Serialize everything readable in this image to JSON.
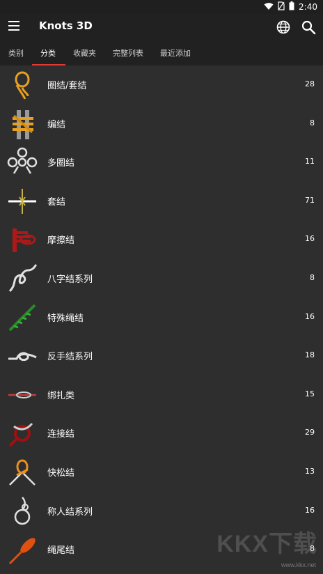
{
  "status_bar": {
    "time": "2:40"
  },
  "app_bar": {
    "title": "Knots 3D"
  },
  "tabs": [
    {
      "label": "类别"
    },
    {
      "label": "分类"
    },
    {
      "label": "收藏夹"
    },
    {
      "label": "完整列表"
    },
    {
      "label": "最近添加"
    }
  ],
  "categories": [
    {
      "label": "圈结/套结",
      "count": "28",
      "color": "#e8a020"
    },
    {
      "label": "编结",
      "count": "8",
      "color": "#e8a020"
    },
    {
      "label": "多圈结",
      "count": "11",
      "color": "#e0e0e0"
    },
    {
      "label": "套结",
      "count": "71",
      "color": "#c8b040"
    },
    {
      "label": "摩擦结",
      "count": "16",
      "color": "#b01818"
    },
    {
      "label": "八字结系列",
      "count": "8",
      "color": "#e0e0e0"
    },
    {
      "label": "特殊绳结",
      "count": "16",
      "color": "#2a8a2a"
    },
    {
      "label": "反手结系列",
      "count": "18",
      "color": "#e0e0e0"
    },
    {
      "label": "绑扎类",
      "count": "15",
      "color": "#c04040"
    },
    {
      "label": "连接结",
      "count": "29",
      "color": "#a01010"
    },
    {
      "label": "快松结",
      "count": "13",
      "color": "#e89020"
    },
    {
      "label": "称人结系列",
      "count": "16",
      "color": "#e0e0e0"
    },
    {
      "label": "绳尾结",
      "count": "8",
      "color": "#e05010"
    }
  ],
  "watermark": {
    "text": "KKX下载",
    "url": "www.kkx.net"
  }
}
